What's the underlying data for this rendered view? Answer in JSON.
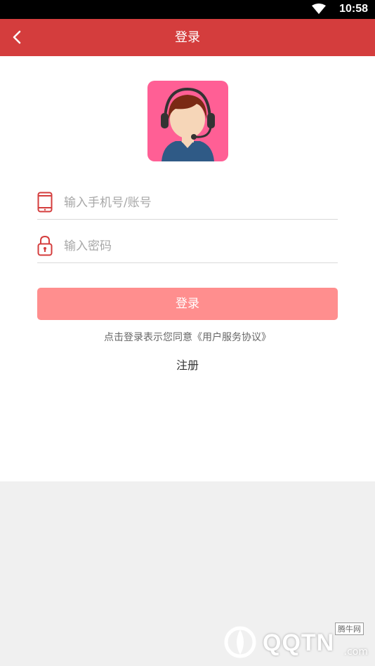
{
  "status_bar": {
    "time": "10:58",
    "wifi_icon": "wifi-icon"
  },
  "header": {
    "title": "登录",
    "back_icon": "back-arrow-icon"
  },
  "avatar": {
    "icon": "customer-service-avatar-icon",
    "background": "#ff5f95"
  },
  "form": {
    "phone": {
      "icon": "phone-icon",
      "placeholder": "输入手机号/账号",
      "value": ""
    },
    "password": {
      "icon": "lock-icon",
      "placeholder": "输入密码",
      "value": ""
    }
  },
  "login_button": {
    "label": "登录",
    "color": "#ff8e8e"
  },
  "agreement": {
    "prefix": "点击登录表示您同意",
    "link": "《用户服务协议》"
  },
  "register": {
    "label": "注册"
  },
  "watermark": {
    "brand": "QQTN",
    "domain": ".com",
    "sub": "腾牛网"
  },
  "colors": {
    "primary": "#d43d3d",
    "accent": "#ff8e8e",
    "page_bg": "#f0f0f0"
  }
}
